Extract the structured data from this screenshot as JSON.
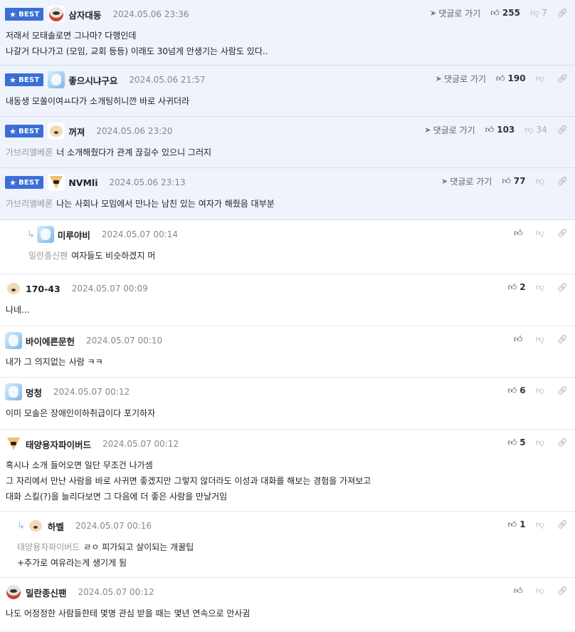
{
  "ui": {
    "badge_label": "BEST",
    "goto_label": "댓글로 가기"
  },
  "comments": [
    {
      "best": true,
      "avatar": "dog-red",
      "nick": "삼자대동",
      "date": "2024.05.06 23:36",
      "goto": true,
      "up": "255",
      "down": "7",
      "lines": [
        "저래서 모태솔로면 그나마? 다행인데",
        "나갈거 다나가고 (모임, 교회 등등) 이래도 30넘게 안생기는 사람도 있다.."
      ]
    },
    {
      "best": true,
      "avatar": "blue",
      "nick": "좋으시냐구요",
      "date": "2024.05.06 21:57",
      "goto": true,
      "up": "190",
      "down": "",
      "lines": [
        "내동생 모쏠이여ㅛ다가 소개팅히니깐 바로 사귀더라"
      ]
    },
    {
      "best": true,
      "avatar": "dog",
      "nick": "꺼져",
      "date": "2024.05.06 23:20",
      "goto": true,
      "up": "103",
      "down": "34",
      "mention": "가브리엘베론",
      "lines": [
        "너 소개해줬다가 관계 끊길수 있으니 그러지"
      ]
    },
    {
      "best": true,
      "avatar": "fox",
      "nick": "NVMli",
      "date": "2024.05.06 23:13",
      "goto": true,
      "up": "77",
      "down": "",
      "mention": "가브리엘베론",
      "lines": [
        "나는 사회나 모임에서 만나는 남친 있는 여자가 해줬음 대부분"
      ]
    },
    {
      "reply": true,
      "level": 1,
      "avatar": "blue",
      "nick": "미루야비",
      "date": "2024.05.07 00:14",
      "up": "",
      "down": "",
      "mention": "밀란종신팬",
      "lines": [
        "여자들도 비슷하겠지 머"
      ]
    },
    {
      "avatar": "dog",
      "nick": "170-43",
      "date": "2024.05.07 00:09",
      "up": "2",
      "down": "",
      "lines": [
        "나네..."
      ]
    },
    {
      "avatar": "blue",
      "nick": "바이에른문헌",
      "date": "2024.05.07 00:10",
      "up": "",
      "down": "",
      "lines": [
        "내가 그 의지없는 사람 ㅋㅋ"
      ]
    },
    {
      "avatar": "blue",
      "nick": "멍청",
      "date": "2024.05.07 00:12",
      "up": "6",
      "down": "",
      "lines": [
        "이미 모솔은 장애인이하취급이다 포기하자"
      ]
    },
    {
      "avatar": "fox",
      "nick": "태양용자파이버드",
      "date": "2024.05.07 00:12",
      "up": "5",
      "down": "",
      "lines": [
        "혹시나 소개 들어오면 일단 무조건 나가셈",
        "그 자리에서 만난 사람을 바로 사귀면 좋겠지만 그렇지 않더라도 이성과 대화를 해보는 경험을 가져보고",
        "대화 스킬(?)을 늘리다보면 그 다음에 더 좋은 사람을 만날거임"
      ]
    },
    {
      "reply": true,
      "level": 2,
      "avatar": "dog",
      "nick": "하벨",
      "date": "2024.05.07 00:16",
      "up": "1",
      "down": "",
      "mention": "태양용자파이버드",
      "lines": [
        "ㄹㅇ 피가되고 살이되는 개꿀팁",
        "+추가로 여유라는게 생기게 됨"
      ]
    },
    {
      "avatar": "dog-red",
      "nick": "밀란종신팬",
      "date": "2024.05.07 00:12",
      "up": "",
      "down": "",
      "lines": [
        "나도 어정정한 사람들한테 몇명 관심 받을 때는 몇년 연속으로 안사귐"
      ]
    }
  ]
}
